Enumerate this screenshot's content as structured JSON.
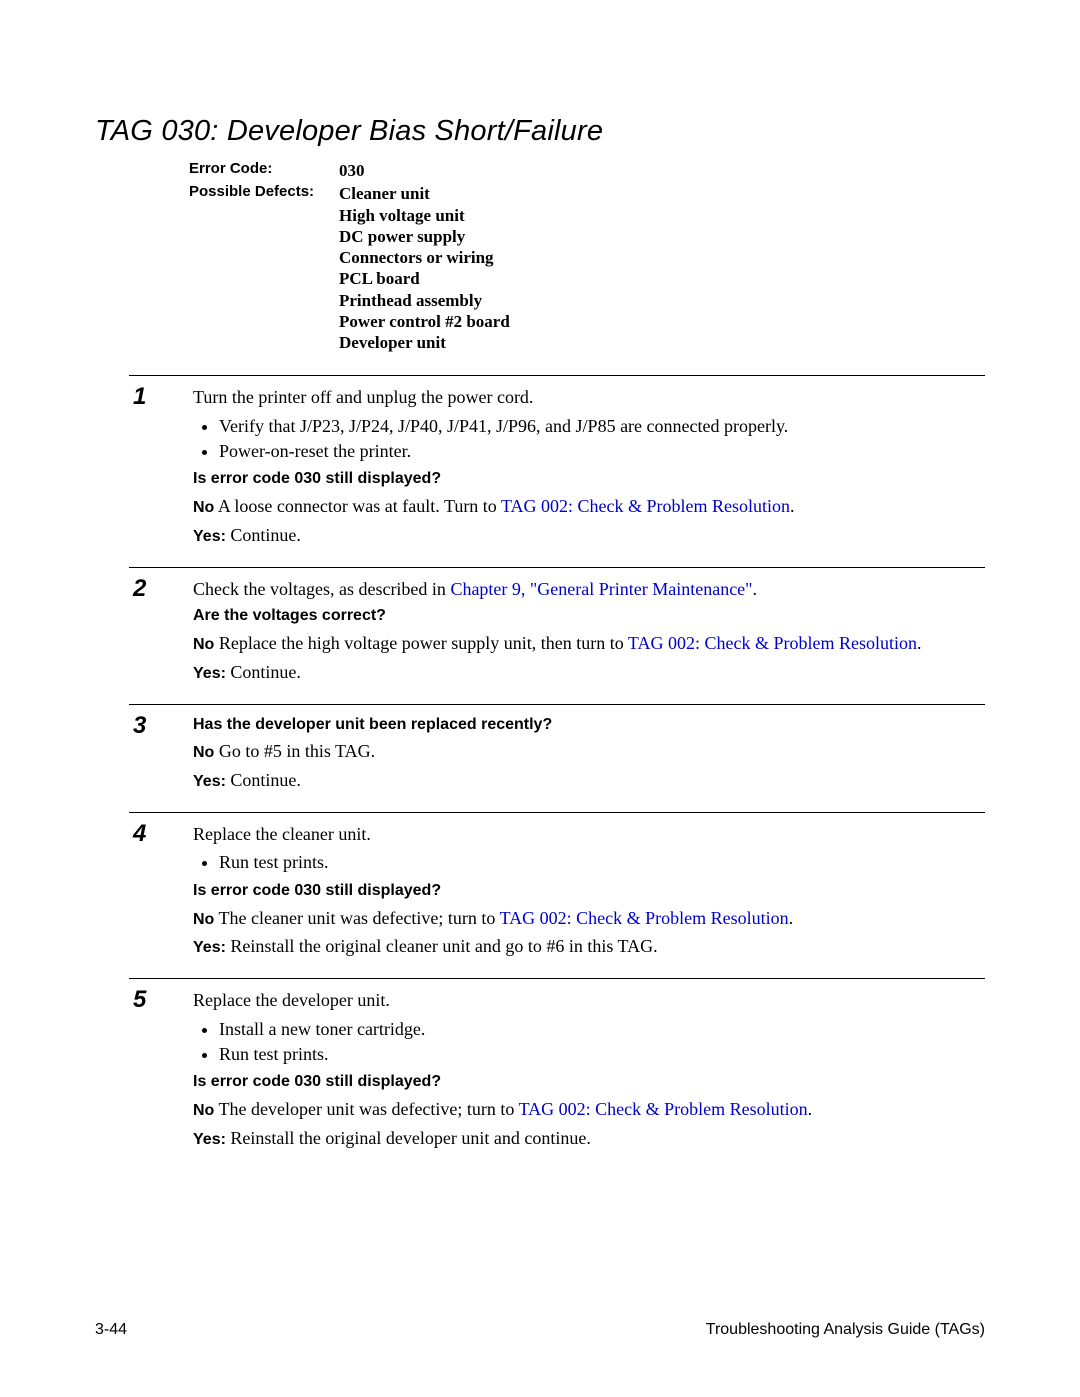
{
  "title": "TAG 030: Developer Bias Short/Failure",
  "meta": {
    "errorCodeLabel": "Error Code:",
    "errorCodeValue": "030",
    "defectsLabel": "Possible Defects:",
    "defects": [
      "Cleaner unit",
      "High voltage unit",
      "DC power supply",
      "Connectors or wiring",
      "PCL board",
      "Printhead assembly",
      "Power control #2 board",
      "Developer unit"
    ]
  },
  "labels": {
    "no": "No",
    "yes": "Yes:"
  },
  "steps": {
    "s1": {
      "num": "1",
      "intro": "Turn the printer off and unplug the power cord.",
      "bullets": [
        "Verify that J/P23, J/P24, J/P40, J/P41, J/P96, and J/P85 are connected properly.",
        "Power-on-reset the printer."
      ],
      "q": "Is error code 030 still displayed?",
      "noPre": "A loose connector was at fault. Turn to ",
      "noLink": "TAG 002: Check & Problem Resolution",
      "noPost": ".",
      "yes": " Continue."
    },
    "s2": {
      "num": "2",
      "introPre": "Check the voltages, as described in ",
      "introLink": "Chapter 9, \"General Printer Maintenance\"",
      "introPost": ".",
      "q": "Are the voltages correct?",
      "noPre": "Replace the high voltage power supply unit, then turn to ",
      "noLink": "TAG 002: Check & Problem Resolution",
      "noPost": ".",
      "yes": " Continue."
    },
    "s3": {
      "num": "3",
      "q": "Has the developer unit been replaced recently?",
      "no": "Go to #5 in this TAG.",
      "yes": " Continue."
    },
    "s4": {
      "num": "4",
      "intro": "Replace the cleaner unit.",
      "bullets": [
        "Run test prints."
      ],
      "q": "Is error code 030 still displayed?",
      "noPre": "The cleaner unit was defective; turn to ",
      "noLink": "TAG 002: Check & Problem Resolution",
      "noPost": ".",
      "yes": " Reinstall the original cleaner unit and go to #6 in this TAG."
    },
    "s5": {
      "num": "5",
      "intro": "Replace the developer unit.",
      "bullets": [
        "Install a new toner cartridge.",
        "Run test prints."
      ],
      "q": "Is error code 030 still displayed?",
      "noPre": "The developer unit was defective; turn to ",
      "noLink": "TAG 002: Check & Problem Resolution",
      "noPost": ".",
      "yes": " Reinstall the original developer unit and continue."
    }
  },
  "footer": {
    "left": "3-44",
    "right": "Troubleshooting Analysis Guide (TAGs)"
  }
}
